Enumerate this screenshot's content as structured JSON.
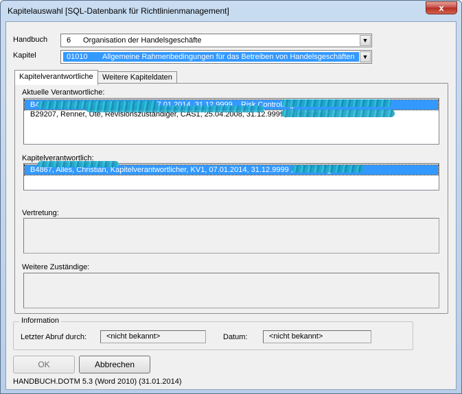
{
  "window": {
    "title": "Kapitelauswahl  [SQL-Datenbank für Richtlinienmanagement]",
    "close_label": "x"
  },
  "form": {
    "handbuch": {
      "label": "Handbuch",
      "number": "6",
      "value": "Organisation der Handelsgeschäfte"
    },
    "kapitel": {
      "label": "Kapitel",
      "number": "01010",
      "value": "Allgemeine Rahmenbedingungen für das Betreiben von Handelsgeschäften"
    }
  },
  "tabs": [
    {
      "label": "Kapitelverantwortliche",
      "active": true
    },
    {
      "label": "Weitere Kapiteldaten",
      "active": false
    }
  ],
  "panel": {
    "aktuelle": {
      "label": "Aktuelle Verantwortliche:",
      "rows": [
        "B4            ,           ,             , Kapitelverantwortlicher, KV1, 07.01.2014, 31.12.9999,              , Risk Controlling",
        "B29207, Renner, Ute, Revisionszuständiger, CAS1, 25.04.2008, 31.12.9999,                               & Prozesse"
      ]
    },
    "kapitelverantwortlich": {
      "label": "Kapitelverantwortlich:",
      "rows": [
        "B4867, Alles, Christian, Kapitelverantwortlicher, KV1, 07.01.2014, 31.12.9999                    , Controlling"
      ]
    },
    "vertretung": {
      "label": "Vertretung:"
    },
    "weitere": {
      "label": "Weitere Zuständige:"
    }
  },
  "information": {
    "legend": "Information",
    "abruf_label": "Letzter Abruf durch:",
    "abruf_value": "<nicht bekannt>",
    "datum_label": "Datum:",
    "datum_value": "<nicht bekannt>"
  },
  "buttons": {
    "ok": "OK",
    "cancel": "Abbrechen"
  },
  "footer": "HANDBUCH.DOTM 5.3 (Word 2010) (31.01.2014)",
  "colors": {
    "selection": "#3399ff",
    "redaction": "#1fa6c9",
    "close": "#c75050"
  }
}
